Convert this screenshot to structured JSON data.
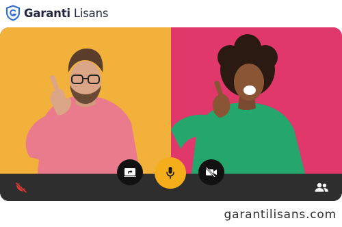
{
  "brand": {
    "name_bold": "Garanti",
    "name_light": "Lisans",
    "logo_icon": "shield-logo-icon",
    "logo_color": "#2f6ed8",
    "text_color": "#21263f"
  },
  "call": {
    "participants": [
      {
        "name": "participant-left",
        "background": "#f1b13a"
      },
      {
        "name": "participant-right",
        "background": "#e0386b"
      }
    ],
    "controls": {
      "share_screen_icon": "screen-share-icon",
      "mic_icon": "microphone-icon",
      "mic_color": "#f4ae1c",
      "camera_icon": "video-off-icon",
      "end_call_icon": "call-end-icon",
      "end_call_color": "#e53935",
      "participants_icon": "people-icon"
    }
  },
  "footer": {
    "site_url": "garantilisans.com"
  }
}
